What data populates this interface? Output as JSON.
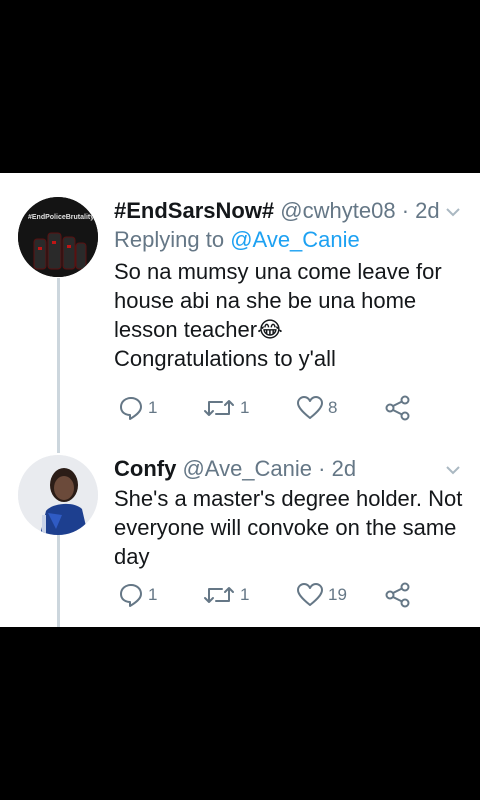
{
  "tweets": [
    {
      "display_name": "#EndSarsNow#",
      "handle": "@cwhyte08",
      "time": "2d",
      "replying_prefix": "Replying to",
      "replying_to": "@Ave_Canie",
      "text": "So na mumsy una come leave for\nhouse abi na she be una home\nlesson teacher😂\nCongratulations to y'all",
      "avatar_text": "#EndPoliceBrutality",
      "replies": "1",
      "retweets": "1",
      "likes": "8"
    },
    {
      "display_name": "Confy",
      "handle": "@Ave_Canie",
      "time": "2d",
      "text": "She's a master's degree holder. Not\neveryone will convoke on the same\nday",
      "replies": "1",
      "retweets": "1",
      "likes": "19"
    }
  ],
  "separator": " · ",
  "colors": {
    "text": "#14171a",
    "secondary": "#657786",
    "link": "#1da1f2",
    "thread_line": "#ccd6dd"
  }
}
